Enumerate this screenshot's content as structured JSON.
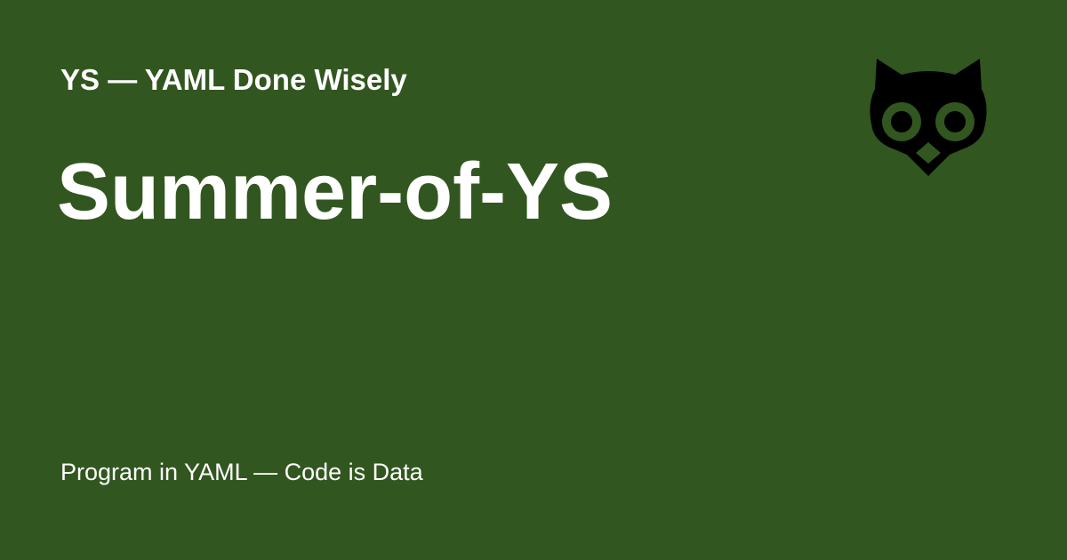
{
  "header": {
    "site_title": "YS — YAML Done Wisely",
    "logo": "owl-logo-icon"
  },
  "main": {
    "page_title": "Summer-of-YS"
  },
  "footer": {
    "tagline": "Program in YAML — Code is Data"
  },
  "colors": {
    "background": "#32561f",
    "text": "#ffffff",
    "logo": "#000000"
  }
}
